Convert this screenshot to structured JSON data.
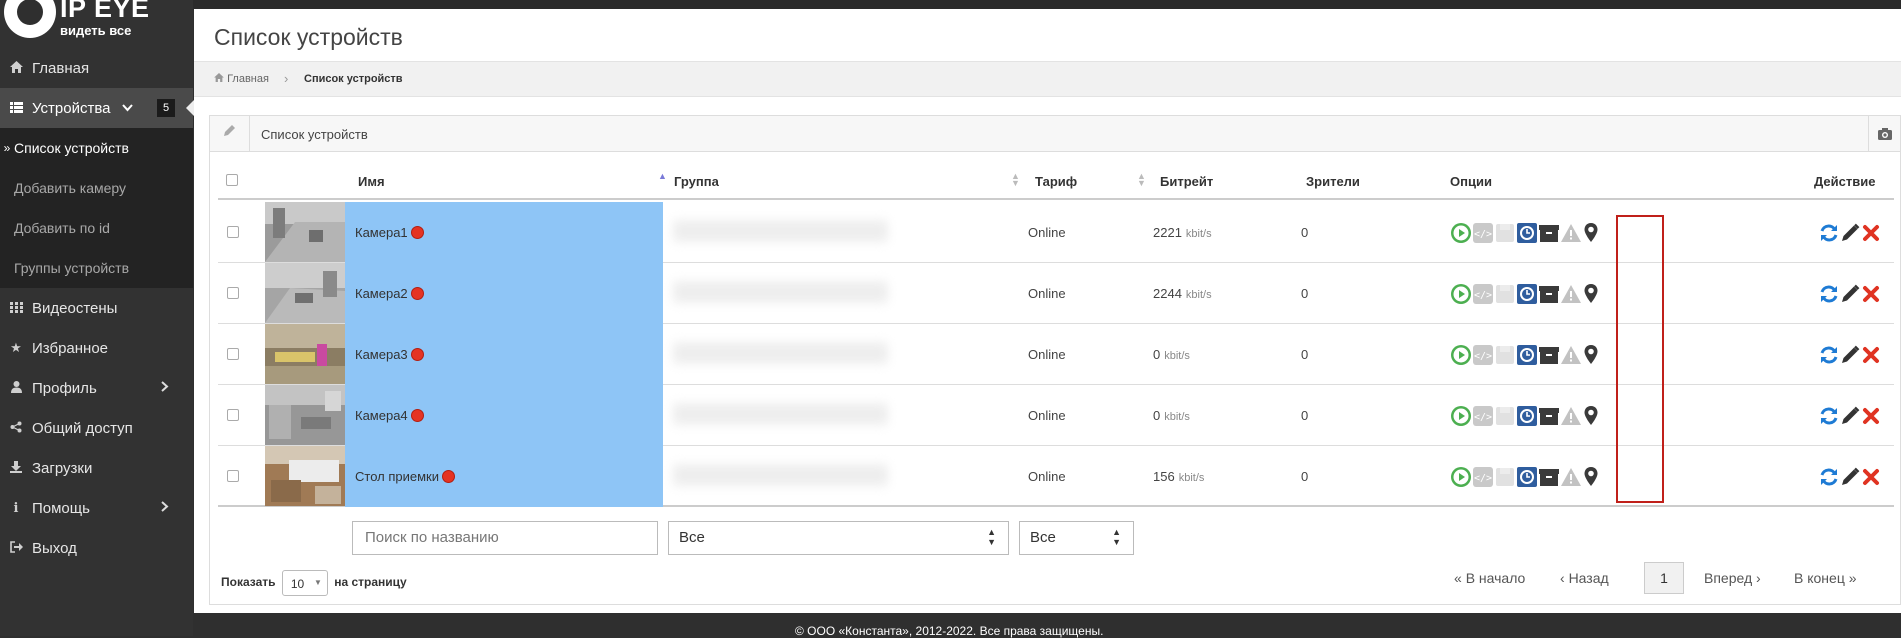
{
  "brand": {
    "title": "IP EYE",
    "subtitle": "видеть все"
  },
  "sidebar": {
    "items": [
      {
        "label": "Главная",
        "icon": "home-icon"
      },
      {
        "label": "Устройства",
        "icon": "list-icon",
        "badge": "5"
      },
      {
        "label": "Видеостены",
        "icon": "grid-icon"
      },
      {
        "label": "Избранное",
        "icon": "star-icon"
      },
      {
        "label": "Профиль",
        "icon": "user-icon"
      },
      {
        "label": "Общий доступ",
        "icon": "share-icon"
      },
      {
        "label": "Загрузки",
        "icon": "download-icon"
      },
      {
        "label": "Помощь",
        "icon": "info-icon"
      },
      {
        "label": "Выход",
        "icon": "logout-icon"
      }
    ],
    "sub_items": [
      {
        "label": "Список устройств"
      },
      {
        "label": "Добавить камеру"
      },
      {
        "label": "Добавить по id"
      },
      {
        "label": "Группы устройств"
      }
    ]
  },
  "page": {
    "title": "Список устройств"
  },
  "breadcrumb": {
    "home": "Главная",
    "current": "Список устройств"
  },
  "box": {
    "title": "Список устройств"
  },
  "table": {
    "headers": {
      "name": "Имя",
      "group": "Группа",
      "tariff": "Тариф",
      "bitrate": "Битрейт",
      "viewers": "Зрители",
      "options": "Опции",
      "actions": "Действие"
    },
    "rows": [
      {
        "name": "Камера1",
        "tariff": "Online",
        "bitrate": "2221",
        "unit": "kbit/s",
        "viewers": "0"
      },
      {
        "name": "Камера2",
        "tariff": "Online",
        "bitrate": "2244",
        "unit": "kbit/s",
        "viewers": "0"
      },
      {
        "name": "Камера3",
        "tariff": "Online",
        "bitrate": "0",
        "unit": "kbit/s",
        "viewers": "0"
      },
      {
        "name": "Камера4",
        "tariff": "Online",
        "bitrate": "0",
        "unit": "kbit/s",
        "viewers": "0"
      },
      {
        "name": "Стол приемки",
        "tariff": "Online",
        "bitrate": "156",
        "unit": "kbit/s",
        "viewers": "0"
      }
    ]
  },
  "filters": {
    "search_placeholder": "Поиск по названию",
    "group_value": "Все",
    "tariff_value": "Все"
  },
  "pagination": {
    "show_label": "Показать",
    "per_page": "10",
    "per_page_suffix": "на страницу",
    "first": "В начало",
    "prev": "Назад",
    "current": "1",
    "next": "Вперед",
    "last": "В конец"
  },
  "footer": {
    "copyright": "© ООО «Константа», 2012-2022. Все права защищены."
  },
  "colors": {
    "name_cell": "#8ec5f6",
    "play": "#4caf50",
    "clock": "#2f5d9e",
    "refresh": "#1e7bd4",
    "delete": "#e03322",
    "highlight": "#c0201a"
  }
}
